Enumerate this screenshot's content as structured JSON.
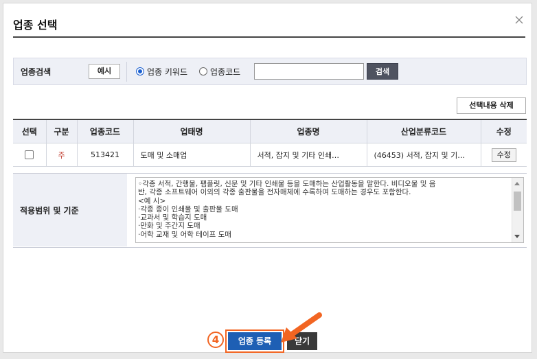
{
  "dialog": {
    "title": "업종 선택"
  },
  "search": {
    "label": "업종검색",
    "example_button": "예시",
    "radio_keyword": "업종 키워드",
    "radio_code": "업종코드",
    "input_value": "",
    "search_button": "검색"
  },
  "toolbar": {
    "delete_label": "선택내용 삭제"
  },
  "table": {
    "headers": {
      "select": "선택",
      "type": "구분",
      "code": "업종코드",
      "business_type": "업태명",
      "business_name": "업종명",
      "industry_code": "산업분류코드",
      "edit": "수정"
    },
    "rows": [
      {
        "type": "주",
        "code": "513421",
        "business_type": "도매 및 소매업",
        "business_name": "서적, 잡지 및 기타 인쇄…",
        "industry_code": "(46453) 서적, 잡지 및 기…",
        "edit": "수정"
      }
    ]
  },
  "scope": {
    "label": "적용범위 및 기준",
    "lines": [
      "◦각종 서적, 간행물, 팸플릿, 신문 및 기타 인쇄물 등을 도매하는 산업활동을 말한다. 비디오물 및 음",
      "반, 각종 소프트웨어 이외의 각종 출판물을 전자매체에 수록하여 도매하는 경우도 포함한다.",
      "<예 시>",
      "·각종 종이 인쇄물 및 출판물 도매",
      "·교과서 및 학습지 도매",
      "·만화 및 주간지 도매",
      "·어학 교재 및 어학 테이프 도매"
    ]
  },
  "footer": {
    "step_badge": "4",
    "register_button": "업종 등록",
    "close_button": "닫기"
  },
  "colors": {
    "accent": "#f26522",
    "primary_button": "#1e5fb4",
    "header_bg": "#eef0f6",
    "primary_mark": "#c0392b"
  }
}
